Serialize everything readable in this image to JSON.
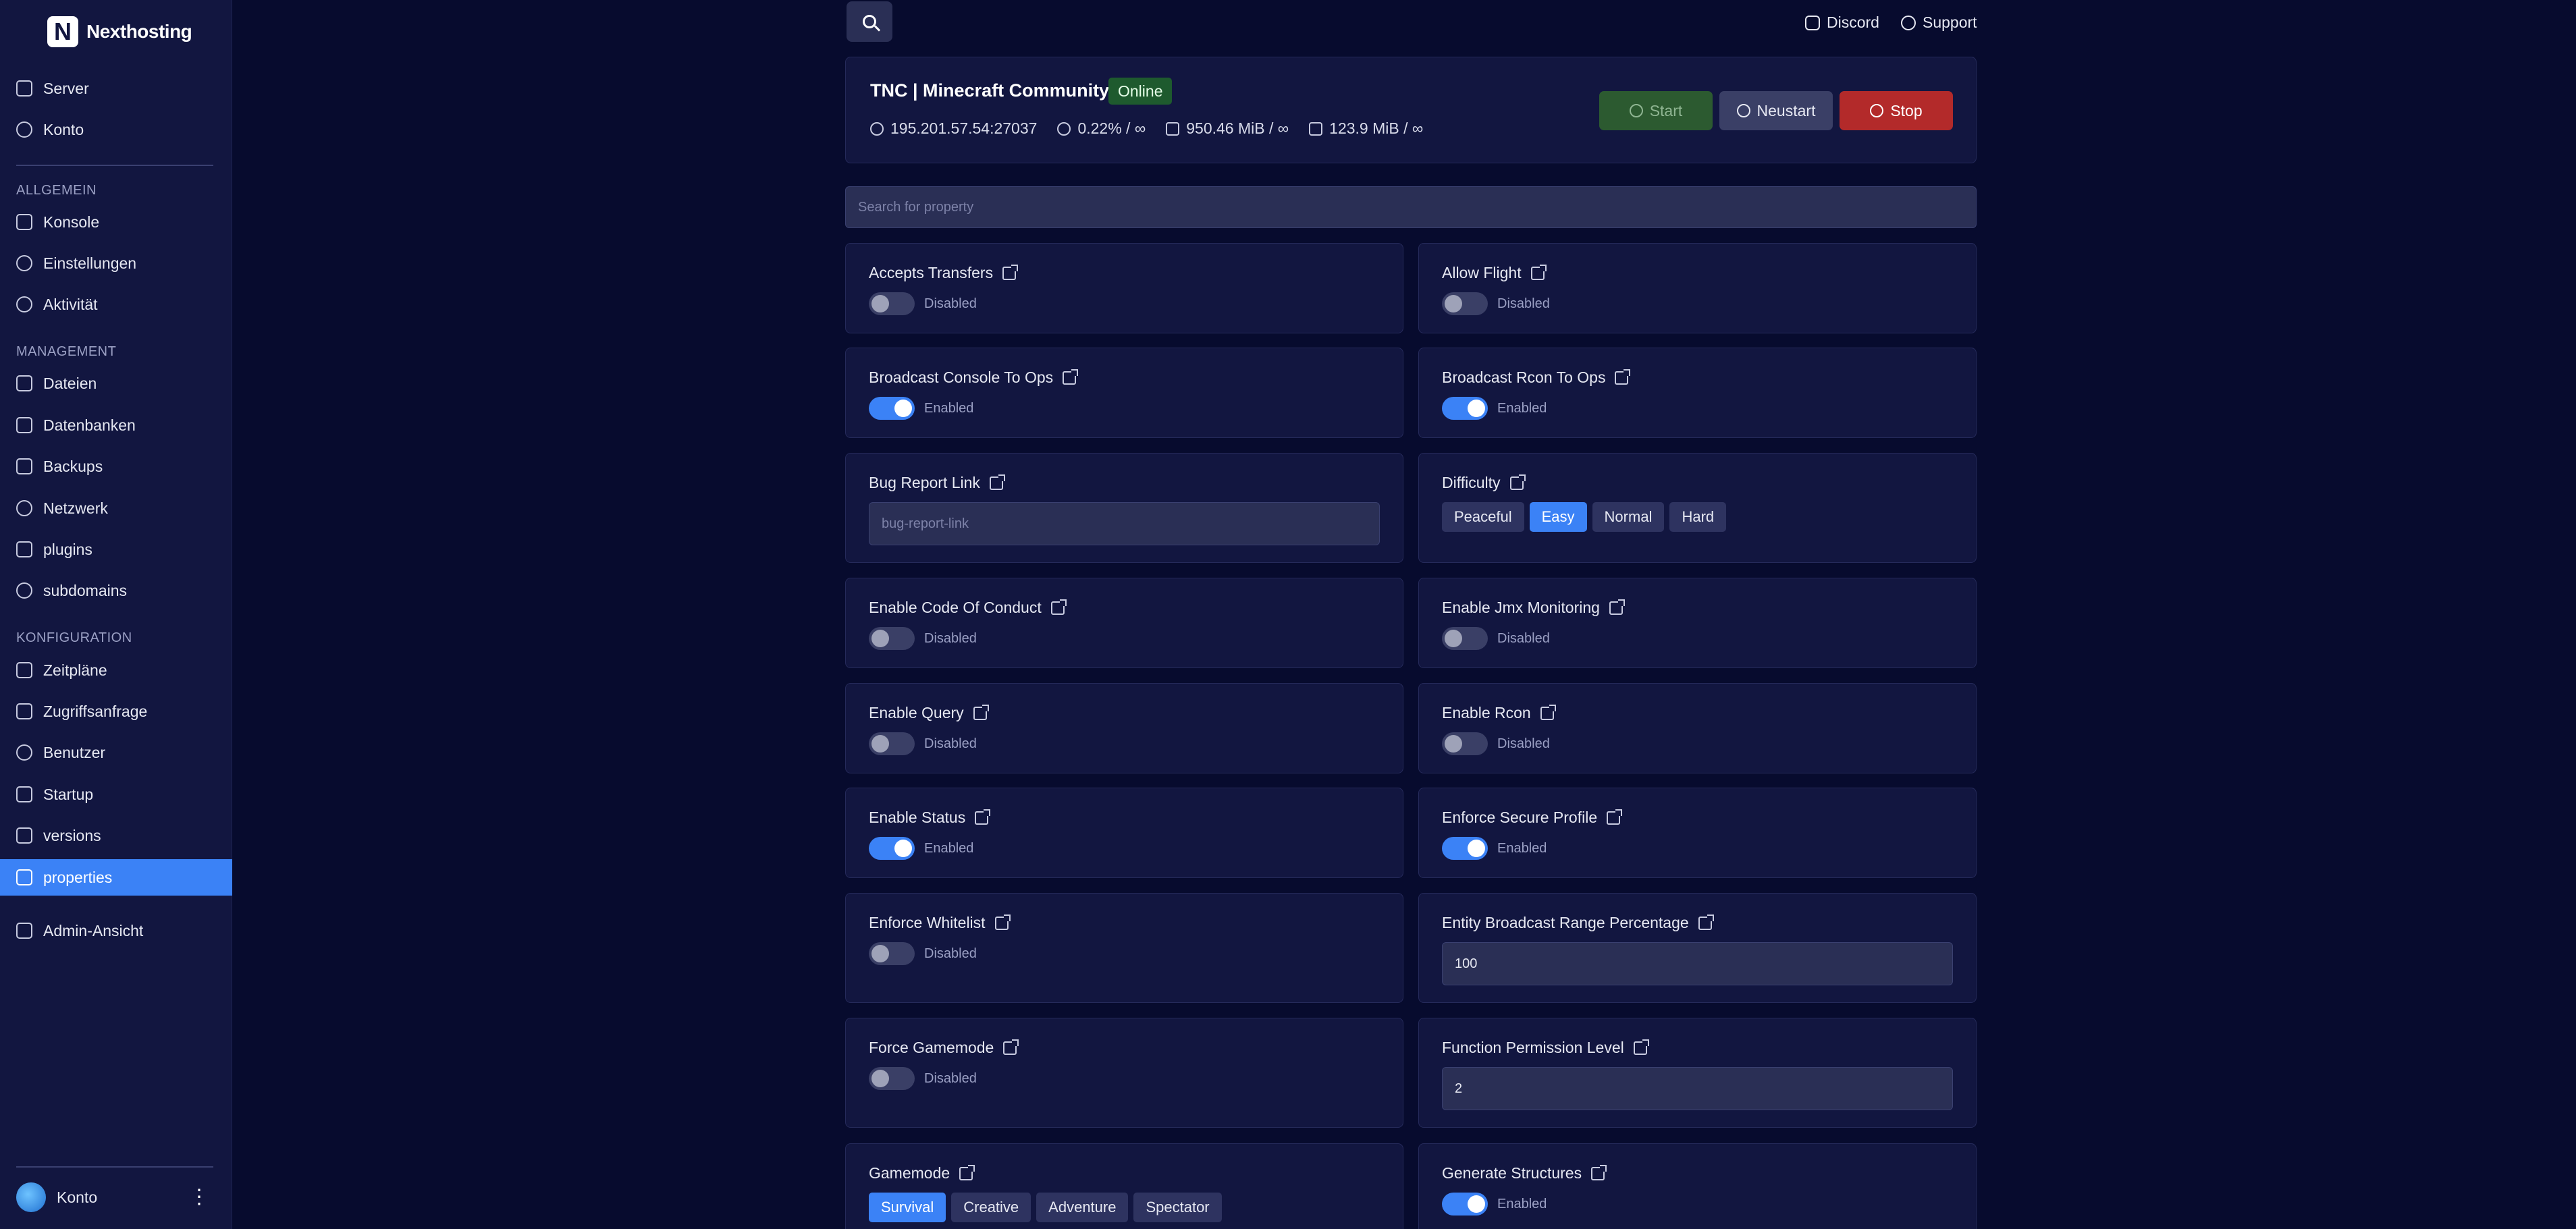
{
  "brand": {
    "logo_letter": "N",
    "name": "Nexthosting"
  },
  "sidebar": {
    "top_items": [
      {
        "label": "Server",
        "icon": "server-icon"
      },
      {
        "label": "Konto",
        "icon": "user-circle-icon"
      }
    ],
    "sections": [
      {
        "label": "ALLGEMEIN",
        "items": [
          {
            "label": "Konsole",
            "icon": "terminal-icon"
          },
          {
            "label": "Einstellungen",
            "icon": "gear-icon"
          },
          {
            "label": "Aktivität",
            "icon": "eye-icon"
          }
        ]
      },
      {
        "label": "MANAGEMENT",
        "items": [
          {
            "label": "Dateien",
            "icon": "folder-icon"
          },
          {
            "label": "Datenbanken",
            "icon": "database-icon"
          },
          {
            "label": "Backups",
            "icon": "archive-icon"
          },
          {
            "label": "Netzwerk",
            "icon": "network-icon"
          },
          {
            "label": "plugins",
            "icon": "file-icon"
          },
          {
            "label": "subdomains",
            "icon": "globe-icon"
          }
        ]
      },
      {
        "label": "KONFIGURATION",
        "items": [
          {
            "label": "Zeitpläne",
            "icon": "calendar-icon"
          },
          {
            "label": "Zugriffsanfrage",
            "icon": "file-icon"
          },
          {
            "label": "Benutzer",
            "icon": "users-icon"
          },
          {
            "label": "Startup",
            "icon": "sliders-icon"
          },
          {
            "label": "versions",
            "icon": "layers-icon"
          },
          {
            "label": "properties",
            "icon": "file-icon",
            "active": true
          }
        ]
      }
    ],
    "admin_link": "Admin-Ansicht",
    "account_label": "Konto"
  },
  "topbar": {
    "discord": "Discord",
    "support": "Support"
  },
  "server": {
    "name": "TNC | Minecraft Community",
    "status": "Online",
    "address": "195.201.57.54:27037",
    "cpu": "0.22% / ∞",
    "memory": "950.46 MiB / ∞",
    "disk": "123.9 MiB / ∞",
    "buttons": {
      "start": "Start",
      "restart": "Neustart",
      "stop": "Stop"
    }
  },
  "search": {
    "placeholder": "Search for property"
  },
  "properties": {
    "accepts_transfers": {
      "label": "Accepts Transfers",
      "state": "Disabled"
    },
    "allow_flight": {
      "label": "Allow Flight",
      "state": "Disabled"
    },
    "broadcast_console_to_ops": {
      "label": "Broadcast Console To Ops",
      "state": "Enabled"
    },
    "broadcast_rcon_to_ops": {
      "label": "Broadcast Rcon To Ops",
      "state": "Enabled"
    },
    "bug_report_link": {
      "label": "Bug Report Link",
      "placeholder": "bug-report-link"
    },
    "difficulty": {
      "label": "Difficulty",
      "options": [
        "Peaceful",
        "Easy",
        "Normal",
        "Hard"
      ],
      "selected": "Easy"
    },
    "enable_code_of_conduct": {
      "label": "Enable Code Of Conduct",
      "state": "Disabled"
    },
    "enable_jmx_monitoring": {
      "label": "Enable Jmx Monitoring",
      "state": "Disabled"
    },
    "enable_query": {
      "label": "Enable Query",
      "state": "Disabled"
    },
    "enable_rcon": {
      "label": "Enable Rcon",
      "state": "Disabled"
    },
    "enable_status": {
      "label": "Enable Status",
      "state": "Enabled"
    },
    "enforce_secure_profile": {
      "label": "Enforce Secure Profile",
      "state": "Enabled"
    },
    "enforce_whitelist": {
      "label": "Enforce Whitelist",
      "state": "Disabled"
    },
    "entity_broadcast_range_percentage": {
      "label": "Entity Broadcast Range Percentage",
      "value": "100"
    },
    "force_gamemode": {
      "label": "Force Gamemode",
      "state": "Disabled"
    },
    "function_permission_level": {
      "label": "Function Permission Level",
      "value": "2"
    },
    "gamemode": {
      "label": "Gamemode",
      "options": [
        "Survival",
        "Creative",
        "Adventure",
        "Spectator"
      ],
      "selected": "Survival"
    },
    "generate_structures": {
      "label": "Generate Structures",
      "state": "Enabled"
    }
  },
  "colors": {
    "accent": "#3b82f6",
    "background": "#070b2e",
    "sidebar": "#121640",
    "online": "#1e5a2e",
    "stop": "#b32a2a"
  }
}
